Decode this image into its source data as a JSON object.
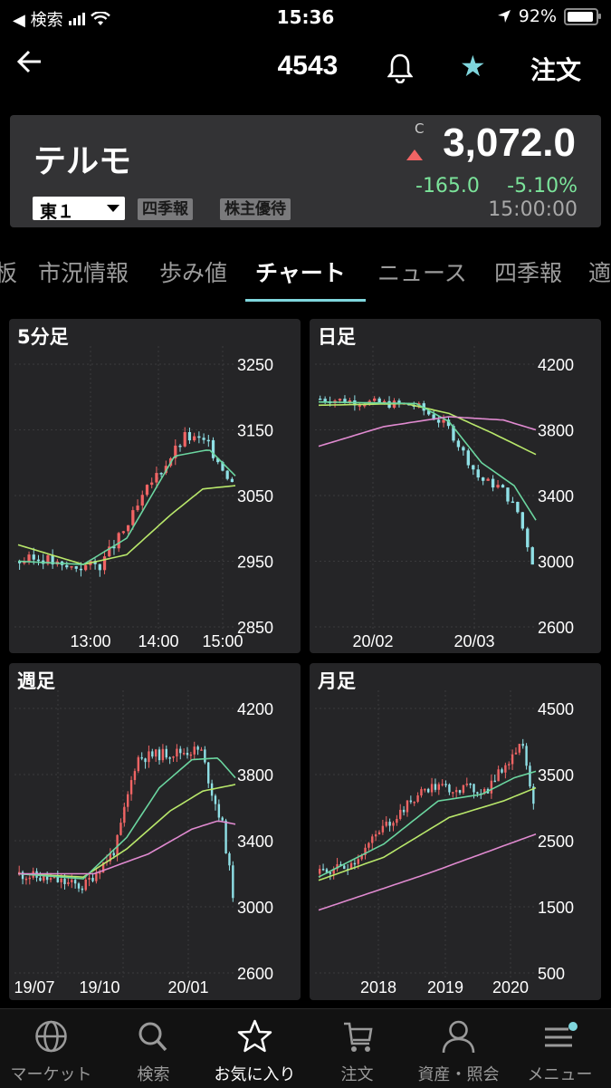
{
  "status": {
    "carrier": "◀ 検索",
    "time": "15:36",
    "battery": "92%",
    "battery_level": 0.92
  },
  "header": {
    "title": "4543",
    "order_label": "注文"
  },
  "quote": {
    "name": "テルモ",
    "market": "東１",
    "tags": [
      "四季報",
      "株主優待"
    ],
    "close_flag": "C",
    "price": "3,072.0",
    "change": "-165.0",
    "change_pct": "-5.10%",
    "time": "15:00:00",
    "colors": {
      "up": "#f06464",
      "down": "#7be39a"
    }
  },
  "tabs": [
    {
      "label": "板",
      "active": false
    },
    {
      "label": "市況情報",
      "active": false
    },
    {
      "label": "歩み値",
      "active": false
    },
    {
      "label": "チャート",
      "active": true
    },
    {
      "label": "ニュース",
      "active": false
    },
    {
      "label": "四季報",
      "active": false
    },
    {
      "label": "適",
      "active": false
    }
  ],
  "chart_data": [
    {
      "type": "candlestick",
      "title": "5分足",
      "y_ticks": [
        "3250",
        "3150",
        "3050",
        "2950",
        "2850"
      ],
      "ylim": [
        2850,
        3250
      ],
      "x_ticks": [
        "13:00",
        "14:00",
        "15:00"
      ],
      "moving_average_colors": [
        "#b9e86b",
        "#6bd6a0"
      ]
    },
    {
      "type": "candlestick",
      "title": "日足",
      "y_ticks": [
        "4200",
        "3800",
        "3400",
        "3000",
        "2600"
      ],
      "ylim": [
        2600,
        4200
      ],
      "x_ticks": [
        "20/02",
        "20/03"
      ],
      "moving_average_colors": [
        "#b9e86b",
        "#6bd6a0",
        "#e08ad0"
      ]
    },
    {
      "type": "candlestick",
      "title": "週足",
      "y_ticks": [
        "4200",
        "3800",
        "3400",
        "3000",
        "2600"
      ],
      "ylim": [
        2600,
        4200
      ],
      "x_ticks": [
        "19/07",
        "19/10",
        "20/01"
      ],
      "moving_average_colors": [
        "#b9e86b",
        "#6bd6a0",
        "#e08ad0"
      ]
    },
    {
      "type": "candlestick",
      "title": "月足",
      "y_ticks": [
        "4500",
        "3500",
        "2500",
        "1500",
        "500"
      ],
      "ylim": [
        500,
        4500
      ],
      "x_ticks": [
        "2018",
        "2019",
        "2020"
      ],
      "moving_average_colors": [
        "#b9e86b",
        "#6bd6a0",
        "#e08ad0"
      ]
    }
  ],
  "tabbar": [
    {
      "label": "マーケット",
      "icon": "globe-icon",
      "active": false
    },
    {
      "label": "検索",
      "icon": "search-icon",
      "active": false
    },
    {
      "label": "お気に入り",
      "icon": "star-icon",
      "active": true
    },
    {
      "label": "注文",
      "icon": "cart-icon",
      "active": false
    },
    {
      "label": "資産・照会",
      "icon": "person-icon",
      "active": false
    },
    {
      "label": "メニュー",
      "icon": "menu-icon",
      "active": false
    }
  ]
}
